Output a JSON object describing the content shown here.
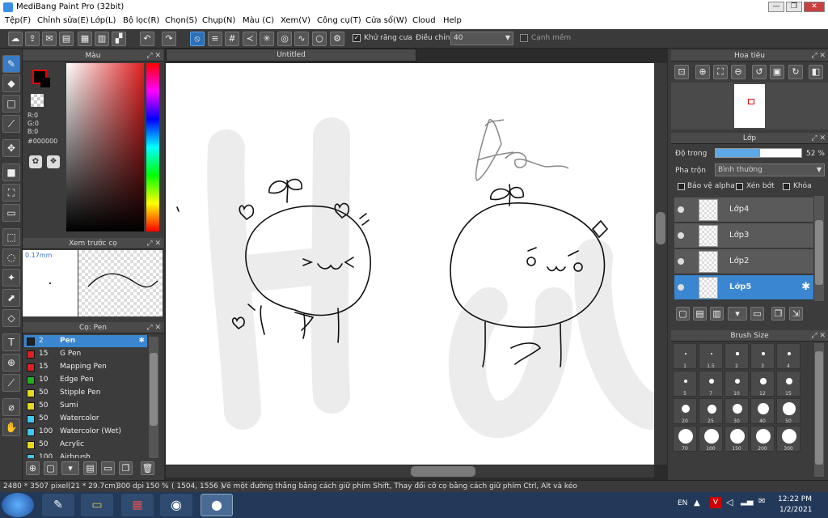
{
  "window": {
    "title": "MediBang Paint Pro (32bit)",
    "minimize": "—",
    "maximize": "❐",
    "close": "✕"
  },
  "menu": [
    "Tệp(F)",
    "Chỉnh sửa(E)",
    "Lớp(L)",
    "Bộ lọc(R)",
    "Chọn(S)",
    "Chụp(N)",
    "Màu (C)",
    "Xem(V)",
    "Công cụ(T)",
    "Cửa sổ(W)",
    "Cloud",
    "Help"
  ],
  "toolbar": {
    "antialias_label": "Khử răng cưa",
    "adjust_label": "Điều chỉnh",
    "adjust_value": "40",
    "smooth_edge_label": "Cạnh mềm"
  },
  "color_panel": {
    "title": "Màu",
    "r": "R:0",
    "g": "G:0",
    "b": "B:0",
    "hex": "#000000"
  },
  "brush_preview": {
    "title": "Xem trước cọ",
    "size": "0.17mm"
  },
  "brush_panel": {
    "title": "Cọ: Pen",
    "items": [
      {
        "size": "2",
        "name": "Pen",
        "color": "#222222",
        "selected": true
      },
      {
        "size": "15",
        "name": "G Pen",
        "color": "#e02020"
      },
      {
        "size": "15",
        "name": "Mapping Pen",
        "color": "#e02020"
      },
      {
        "size": "10",
        "name": "Edge Pen",
        "color": "#20b020"
      },
      {
        "size": "50",
        "name": "Stipple Pen",
        "color": "#e8d820"
      },
      {
        "size": "50",
        "name": "Sumi",
        "color": "#e8d820"
      },
      {
        "size": "50",
        "name": "Watercolor",
        "color": "#40c8f0"
      },
      {
        "size": "100",
        "name": "Watercolor (Wet)",
        "color": "#40c8f0"
      },
      {
        "size": "50",
        "name": "Acrylic",
        "color": "#e8d820"
      },
      {
        "size": "100",
        "name": "Airbrush",
        "color": "#40c8f0"
      }
    ]
  },
  "document": {
    "tab": "Untitled"
  },
  "navigator": {
    "title": "Hoa tiêu"
  },
  "layer_panel": {
    "title": "Lớp",
    "opacity_label": "Độ trong",
    "opacity_value": "52 %",
    "opacity_fraction": 0.52,
    "blend_label": "Pha trộn",
    "blend_value": "Bình thường",
    "protect_alpha": "Bảo vệ alpha",
    "clip": "Xén bớt",
    "lock": "Khóa",
    "layers": [
      {
        "name": "Lớp4",
        "selected": false
      },
      {
        "name": "Lớp3",
        "selected": false
      },
      {
        "name": "Lớp2",
        "selected": false
      },
      {
        "name": "Lớp5",
        "selected": true
      }
    ]
  },
  "brush_size": {
    "title": "Brush Size",
    "sizes": [
      "1",
      "1.5",
      "2",
      "3",
      "4",
      "5",
      "7",
      "10",
      "12",
      "15",
      "20",
      "25",
      "30",
      "40",
      "50",
      "70",
      "100",
      "150",
      "200",
      "300"
    ]
  },
  "status": {
    "dimensions": "2480 * 3507 pixel",
    "cm": "(21 * 29.7cm)",
    "dpi": "300 dpi",
    "zoom": "150 %",
    "coords": "( 1504, 1556 )",
    "hint": "Vẽ một đường thẳng bằng cách giữ phím Shift, Thay đổi cỡ cọ bằng cách giữ phím Ctrl, Alt và kéo"
  },
  "taskbar": {
    "lang": "EN",
    "time": "12:22 PM",
    "date": "1/2/2021"
  },
  "colors": {
    "accent": "#3a86d0",
    "panel": "#3c3c3c"
  }
}
